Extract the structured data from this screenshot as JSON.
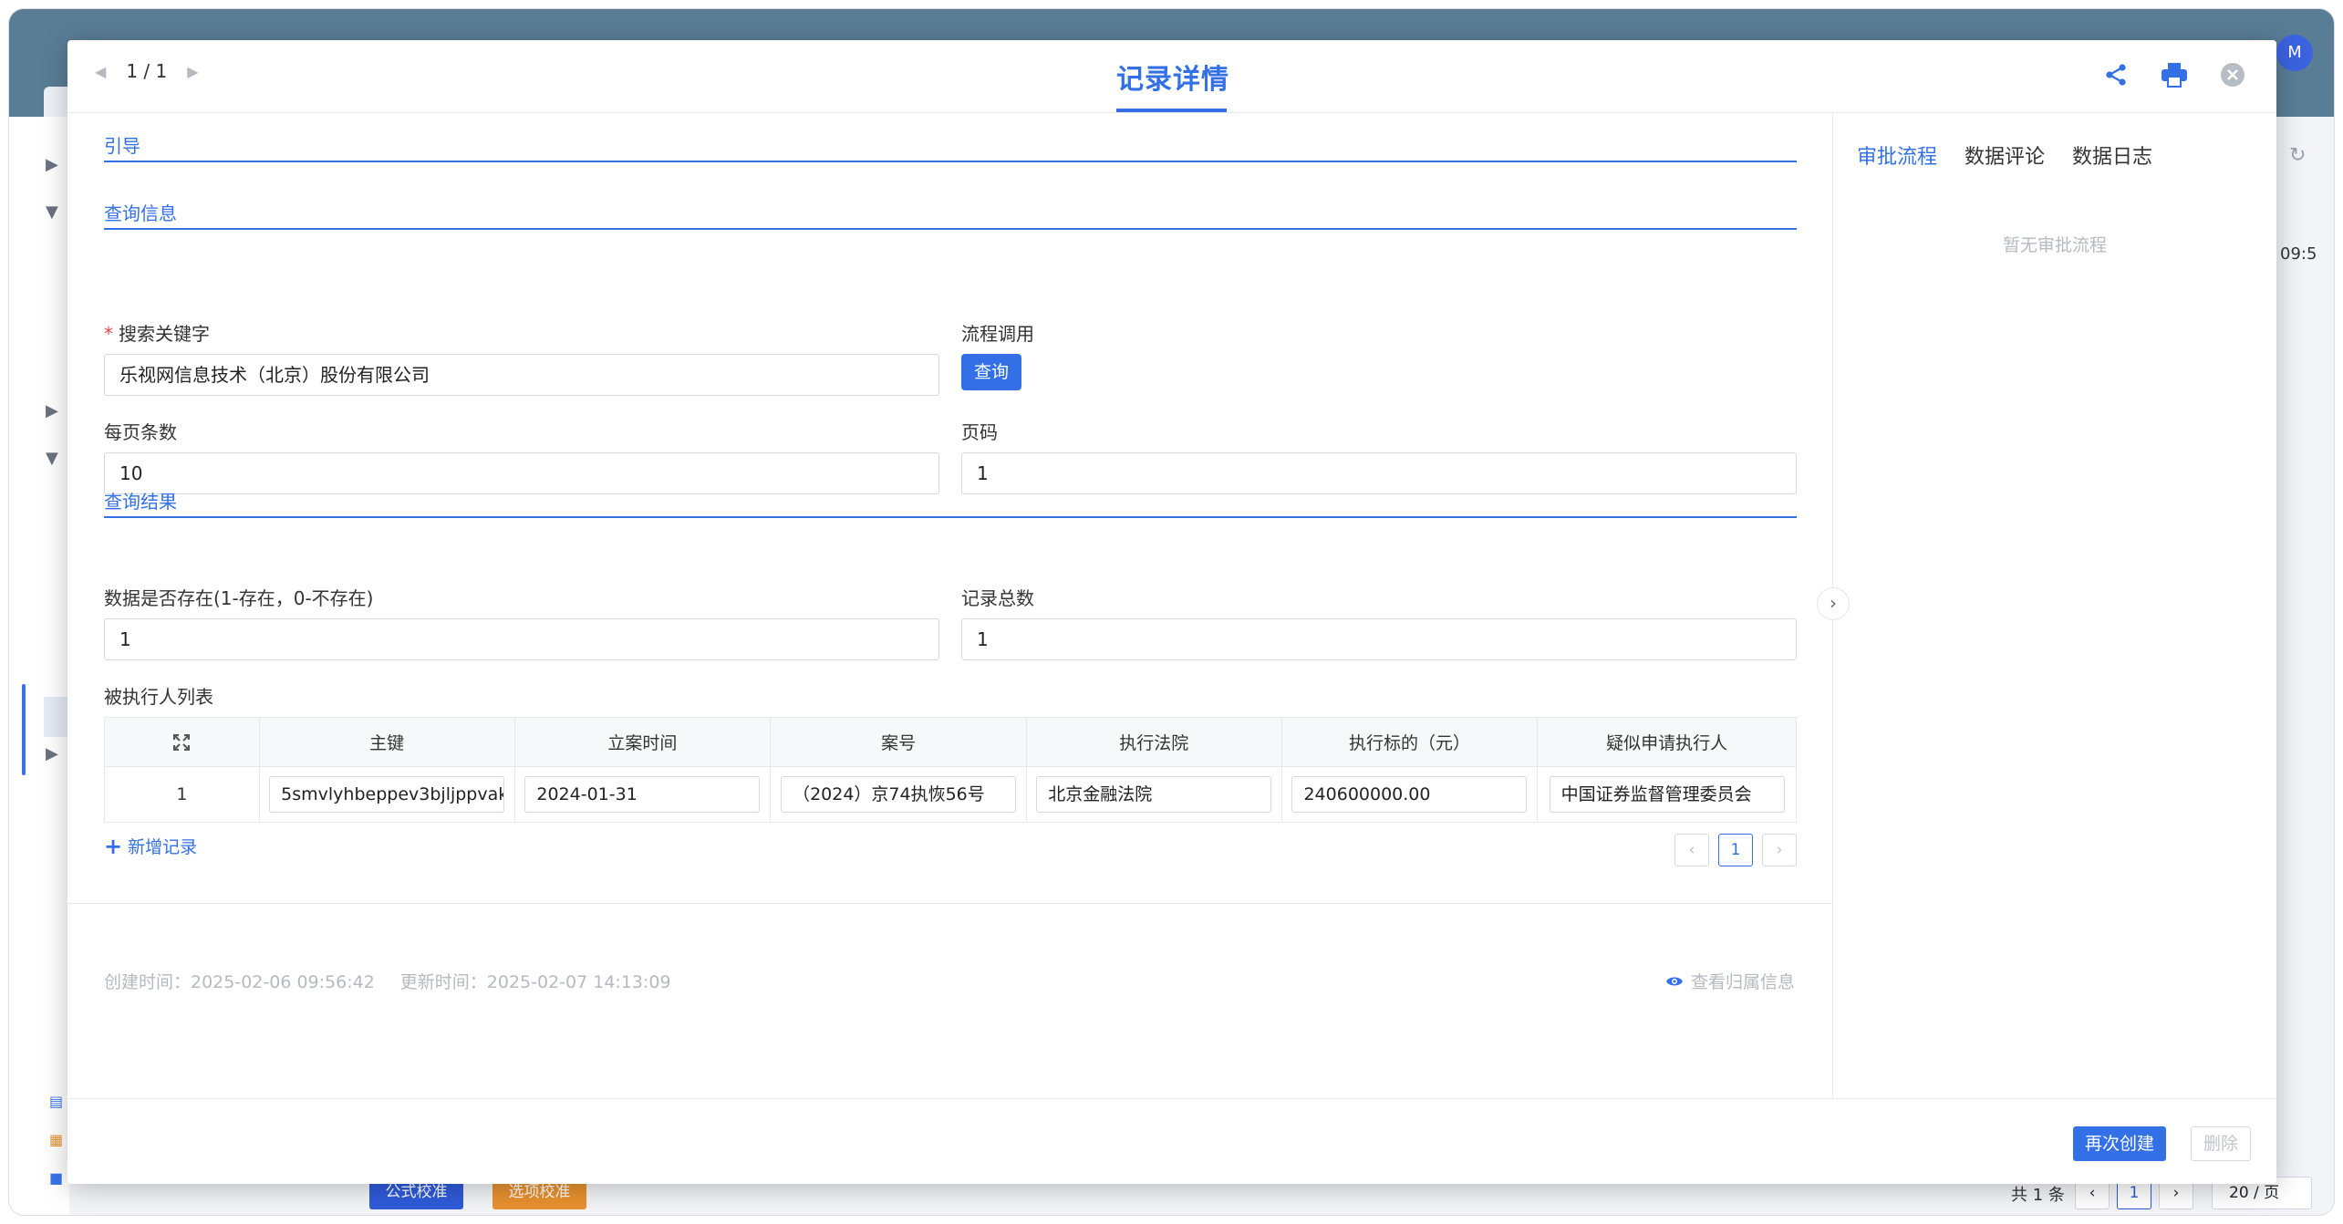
{
  "background": {
    "sidebar_arrows": [
      "▶",
      "▼",
      "▶",
      "▼",
      "▶"
    ],
    "bottom_buttons": [
      "公式校准",
      "选项校准"
    ],
    "total_text": "共 1 条",
    "pager_current": "1",
    "page_size": "20 / 页",
    "time_fragment": "09:5",
    "avatar": "M"
  },
  "modal": {
    "pager": "1 / 1",
    "title": "记录详情",
    "sections": {
      "guide": "引导",
      "query_info": "查询信息",
      "query_result": "查询结果"
    },
    "fields": {
      "keyword_label": "搜索关键字",
      "keyword_value": "乐视网信息技术（北京）股份有限公司",
      "flow_label": "流程调用",
      "flow_button": "查询",
      "page_size_label": "每页条数",
      "page_size_value": "10",
      "page_no_label": "页码",
      "page_no_value": "1",
      "exists_label": "数据是否存在(1-存在，0-不存在)",
      "exists_value": "1",
      "total_label": "记录总数",
      "total_value": "1",
      "list_label": "被执行人列表"
    },
    "table": {
      "headers": [
        "主键",
        "立案时间",
        "案号",
        "执行法院",
        "执行标的（元）",
        "疑似申请执行人"
      ],
      "rows": [
        {
          "index": "1",
          "cells": [
            "5smvlyhbeppev3bjljppvak",
            "2024-01-31",
            "（2024）京74执恢56号",
            "北京金融法院",
            "240600000.00",
            "中国证券监督管理委员会"
          ]
        }
      ],
      "add_record": "新增记录",
      "pager_current": "1"
    },
    "meta": {
      "created": "创建时间：2025-02-06 09:56:42",
      "updated": "更新时间：2025-02-07 14:13:09",
      "belong": "查看归属信息"
    },
    "right_panel": {
      "tabs": [
        "审批流程",
        "数据评论",
        "数据日志"
      ],
      "empty": "暂无审批流程"
    },
    "footer": {
      "recreate": "再次创建",
      "delete": "删除"
    }
  },
  "colors": {
    "accent": "#3370e6",
    "header_bg": "#5a7d96",
    "orange": "#e8912f"
  }
}
